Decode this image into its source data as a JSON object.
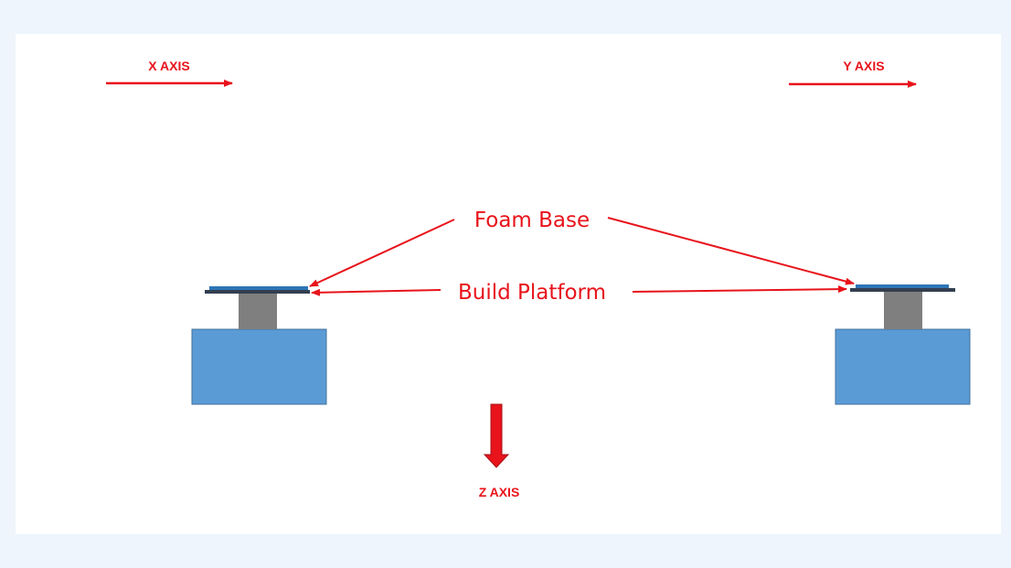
{
  "labels": {
    "x_axis": "X AXIS",
    "y_axis": "Y AXIS",
    "z_axis": "Z AXIS",
    "foam_base": "Foam Base",
    "build_platform": "Build Platform"
  },
  "colors": {
    "background": "#eef5fc",
    "slide": "#ffffff",
    "accent_red": "#e8131b",
    "block_blue": "#5b9bd5",
    "block_border": "#41719c",
    "column_gray": "#7f7f7f",
    "platform_dark": "#333f50",
    "foam_blue": "#2e75b6"
  }
}
